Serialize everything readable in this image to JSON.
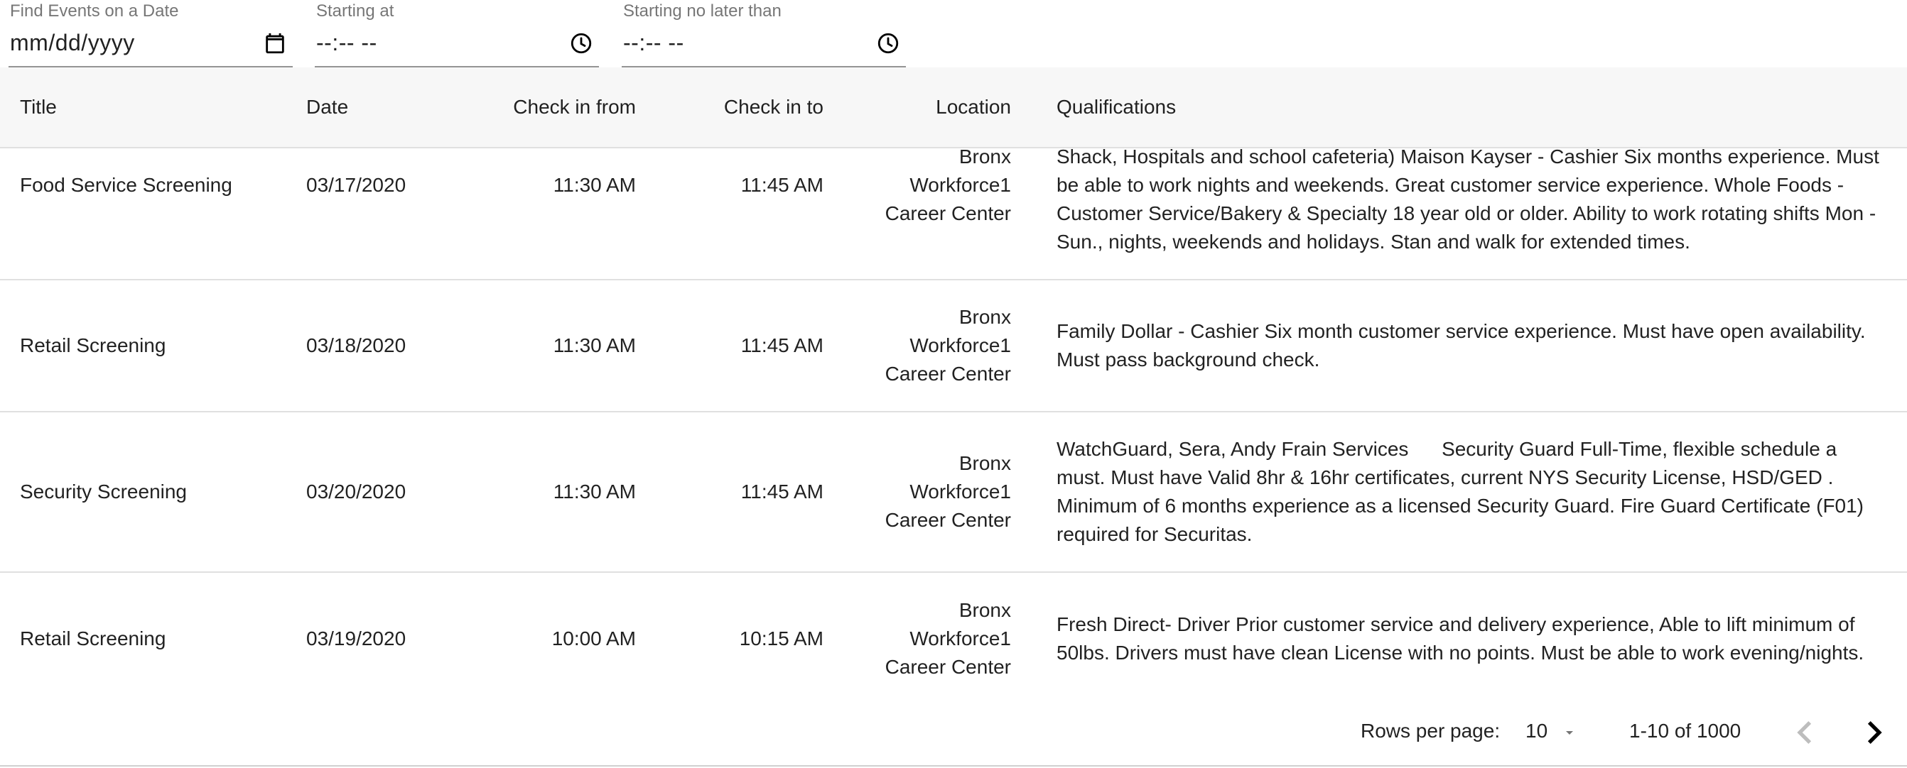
{
  "filters": {
    "date": {
      "label": "Find Events on a Date",
      "value": "mm/dd/yyyy"
    },
    "start": {
      "label": "Starting at",
      "value": "--:-- --"
    },
    "end": {
      "label": "Starting no later than",
      "value": "--:-- --"
    }
  },
  "table": {
    "columns": {
      "title": "Title",
      "date": "Date",
      "check_in_from": "Check in from",
      "check_in_to": "Check in to",
      "location": "Location",
      "qualifications": "Qualifications"
    },
    "rows": [
      {
        "title": "Food Service Screening",
        "date": "03/17/2020",
        "check_in_from": "11:30 AM",
        "check_in_to": "11:45 AM",
        "location": "Bronx Workforce1 Career Center",
        "qualifications": "Shack, Hospitals and school cafeteria) Maison Kayser - Cashier Six months experience. Must be able to work nights and weekends. Great customer service experience. Whole Foods - Customer Service/Bakery & Specialty 18 year old or older. Ability to work rotating shifts Mon - Sun., nights, weekends and holidays. Stan and walk for extended times."
      },
      {
        "title": "Retail Screening",
        "date": "03/18/2020",
        "check_in_from": "11:30 AM",
        "check_in_to": "11:45 AM",
        "location": "Bronx Workforce1 Career Center",
        "qualifications": "Family Dollar - Cashier Six month customer service experience. Must have open availability. Must pass background check."
      },
      {
        "title": "Security Screening",
        "date": "03/20/2020",
        "check_in_from": "11:30 AM",
        "check_in_to": "11:45 AM",
        "location": "Bronx Workforce1 Career Center",
        "qualifications": "WatchGuard, Sera, Andy Frain Services      Security Guard Full-Time, flexible schedule a must. Must have Valid 8hr & 16hr certificates, current NYS Security License, HSD/GED . Minimum of 6 months experience as a licensed Security Guard. Fire Guard Certificate (F01) required for Securitas."
      },
      {
        "title": "Retail Screening",
        "date": "03/19/2020",
        "check_in_from": "10:00 AM",
        "check_in_to": "10:15 AM",
        "location": "Bronx Workforce1 Career Center",
        "qualifications": "Fresh Direct- Driver Prior customer service and delivery experience, Able to lift minimum of 50lbs. Drivers must have clean License with no points. Must be able to work evening/nights."
      }
    ]
  },
  "pagination": {
    "rows_per_page_label": "Rows per page:",
    "rows_per_page": "10",
    "range": "1-10 of 1000"
  },
  "icons": {
    "calendar": "calendar-icon",
    "clock": "clock-icon",
    "caret": "arrow-drop-down-icon",
    "prev": "chevron-left-icon",
    "next": "chevron-right-icon"
  }
}
